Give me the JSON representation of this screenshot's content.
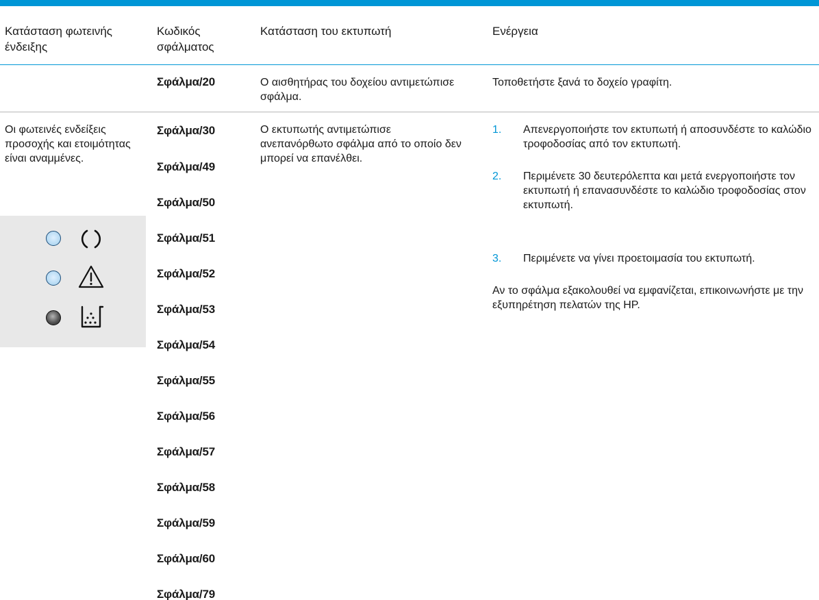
{
  "header": {
    "col_led": "Κατάσταση φωτεινής ένδειξης",
    "col_code": "Κωδικός σφάλματος",
    "col_status": "Κατάσταση του εκτυπωτή",
    "col_action": "Ενέργεια"
  },
  "row1": {
    "code": "Σφάλμα/20",
    "status": "Ο αισθητήρας του δοχείου αντιμετώπισε σφάλμα.",
    "action": "Τοποθετήστε ξανά το δοχείο γραφίτη."
  },
  "row2": {
    "led_state": "Οι φωτεινές ενδείξεις προσοχής και ετοιμότητας είναι αναμμένες.",
    "led_panel": {
      "ready_led": "on",
      "attention_led": "on",
      "toner_led": "off",
      "icons": [
        "power-ready-icon",
        "warning-triangle-icon",
        "toner-icon"
      ]
    },
    "codes": [
      "Σφάλμα/30",
      "Σφάλμα/49",
      "Σφάλμα/50",
      "Σφάλμα/51",
      "Σφάλμα/52",
      "Σφάλμα/53",
      "Σφάλμα/54",
      "Σφάλμα/55",
      "Σφάλμα/56",
      "Σφάλμα/57",
      "Σφάλμα/58",
      "Σφάλμα/59",
      "Σφάλμα/60",
      "Σφάλμα/79"
    ],
    "status": "Ο εκτυπωτής αντιμετώπισε ανεπανόρθωτο σφάλμα από το οποίο δεν μπορεί να επανέλθει.",
    "steps": [
      {
        "num": "1.",
        "text": "Απενεργοποιήστε τον εκτυπωτή ή αποσυνδέστε το καλώδιο τροφοδοσίας από τον εκτυπωτή."
      },
      {
        "num": "2.",
        "text": "Περιμένετε 30 δευτερόλεπτα και μετά ενεργοποιήστε τον εκτυπωτή ή επανασυνδέστε το καλώδιο τροφοδοσίας στον εκτυπωτή."
      },
      {
        "num": "3.",
        "text": "Περιμένετε να γίνει προετοιμασία του εκτυπωτή."
      }
    ],
    "note": "Αν το σφάλμα εξακολουθεί να εμφανίζεται, επικοινωνήστε με την εξυπηρέτηση πελατών της HP."
  },
  "colors": {
    "accent": "#0096d6",
    "rule": "#b7b7b7",
    "panel": "#e8e8e8"
  }
}
